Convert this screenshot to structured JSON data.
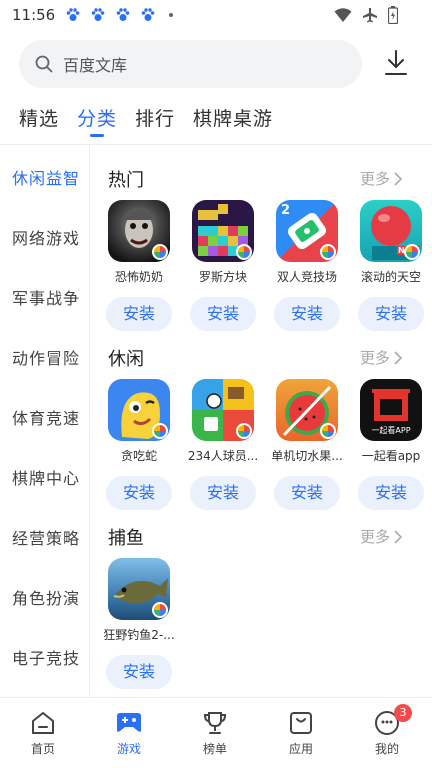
{
  "status_bar": {
    "time": "11:56"
  },
  "search": {
    "placeholder": "百度文库"
  },
  "tabs": [
    {
      "label": "精选"
    },
    {
      "label": "分类"
    },
    {
      "label": "排行"
    },
    {
      "label": "棋牌桌游"
    }
  ],
  "active_tab": "分类",
  "sidebar": {
    "items": [
      {
        "label": "休闲益智"
      },
      {
        "label": "网络游戏"
      },
      {
        "label": "军事战争"
      },
      {
        "label": "动作冒险"
      },
      {
        "label": "体育竞速"
      },
      {
        "label": "棋牌中心"
      },
      {
        "label": "经营策略"
      },
      {
        "label": "角色扮演"
      },
      {
        "label": "电子竞技"
      }
    ]
  },
  "sections": [
    {
      "title": "热门",
      "more": "更多",
      "apps": [
        {
          "name": "恐怖奶奶",
          "install": "安装"
        },
        {
          "name": "罗斯方块",
          "install": "安装"
        },
        {
          "name": "双人竞技场",
          "install": "安装"
        },
        {
          "name": "滚动的天空",
          "install": "安装"
        }
      ]
    },
    {
      "title": "休闲",
      "more": "更多",
      "apps": [
        {
          "name": "贪吃蛇",
          "install": "安装"
        },
        {
          "name": "234人球员...",
          "install": "安装"
        },
        {
          "name": "单机切水果...",
          "install": "安装"
        },
        {
          "name": "一起看app",
          "install": "安装"
        }
      ]
    },
    {
      "title": "捕鱼",
      "more": "更多",
      "apps": [
        {
          "name": "狂野钓鱼2-...",
          "install": "安装"
        }
      ]
    }
  ],
  "icon_text": {
    "newbadge": "NEW",
    "yiqikan": "一起看APP",
    "arena_digit": "2"
  },
  "bottom_nav": [
    {
      "label": "首页"
    },
    {
      "label": "游戏"
    },
    {
      "label": "榜单"
    },
    {
      "label": "应用"
    },
    {
      "label": "我的",
      "badge": "3"
    }
  ],
  "colors": {
    "accent": "#2a6ff5",
    "install_bg": "#eaf0fc",
    "badge": "#f24b4b"
  }
}
